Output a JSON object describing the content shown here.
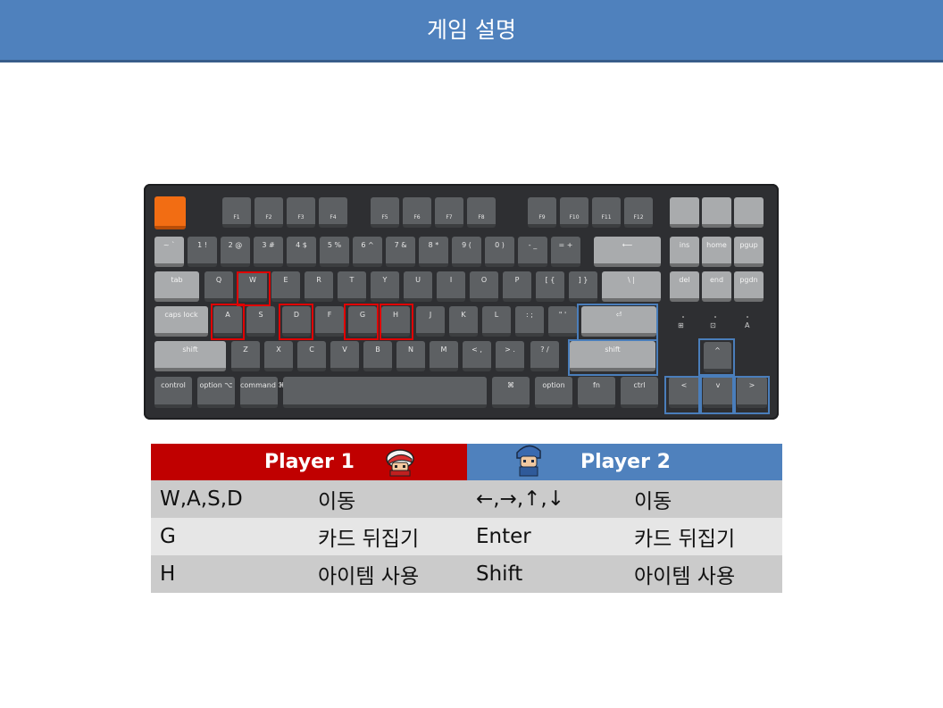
{
  "header": {
    "title": "게임 설명"
  },
  "keyboard": {
    "fn_row": [
      "",
      "☼",
      "☼",
      "⊞",
      "⊞",
      "☼",
      "☼",
      "◀◀",
      "▶‖",
      "▶▶",
      "◀",
      "◀)",
      "◀))",
      "⊡",
      "🎙",
      "💡"
    ],
    "fn_sub": [
      "",
      "F1",
      "F2",
      "F3",
      "F4",
      "F5",
      "F6",
      "F7",
      "F8",
      "F9",
      "F10",
      "F11",
      "F12",
      "",
      "",
      ""
    ],
    "num_row": [
      "~ `",
      "1 !",
      "2 @",
      "3 #",
      "4 $",
      "5 %",
      "6 ^",
      "7 &",
      "8 *",
      "9 (",
      "0 )",
      "- _",
      "= +",
      "⟵",
      "ins",
      "home",
      "pgup"
    ],
    "q_row": [
      "tab",
      "Q",
      "W",
      "E",
      "R",
      "T",
      "Y",
      "U",
      "I",
      "O",
      "P",
      "[ {",
      "] }",
      "\\ |",
      "del",
      "end",
      "pgdn"
    ],
    "a_row": [
      "caps lock",
      "A",
      "S",
      "D",
      "F",
      "G",
      "H",
      "J",
      "K",
      "L",
      ": ;",
      "\" '",
      "⏎"
    ],
    "z_row": [
      "shift",
      "Z",
      "X",
      "C",
      "V",
      "B",
      "N",
      "M",
      "< ,",
      "> .",
      "? /",
      "shift"
    ],
    "bottom_row": [
      "control",
      "option ⌥",
      "command ⌘",
      "",
      "⌘",
      "option",
      "fn",
      "ctrl"
    ],
    "arrows": [
      "^",
      "<",
      "v",
      ">"
    ],
    "indicators": [
      "⊞",
      "⊡",
      "A"
    ]
  },
  "controls_table": {
    "player1": {
      "label": "Player 1",
      "sprite_icon": "trainer-red-icon"
    },
    "player2": {
      "label": "Player 2",
      "sprite_icon": "trainer-blue-icon"
    },
    "rows": [
      {
        "p1_key": "W,A,S,D",
        "p1_action": "이동",
        "p2_key": "←,→,↑,↓",
        "p2_action": "이동"
      },
      {
        "p1_key": "G",
        "p1_action": "카드 뒤집기",
        "p2_key": "Enter",
        "p2_action": "카드 뒤집기"
      },
      {
        "p1_key": "H",
        "p1_action": "아이템 사용",
        "p2_key": "Shift",
        "p2_action": "아이템 사용"
      }
    ]
  },
  "colors": {
    "header_bg": "#4f81bd",
    "player1_bg": "#c00000",
    "player2_bg": "#4f81bd",
    "highlight_p1": "#e00000",
    "highlight_p2": "#4a7ebb"
  }
}
